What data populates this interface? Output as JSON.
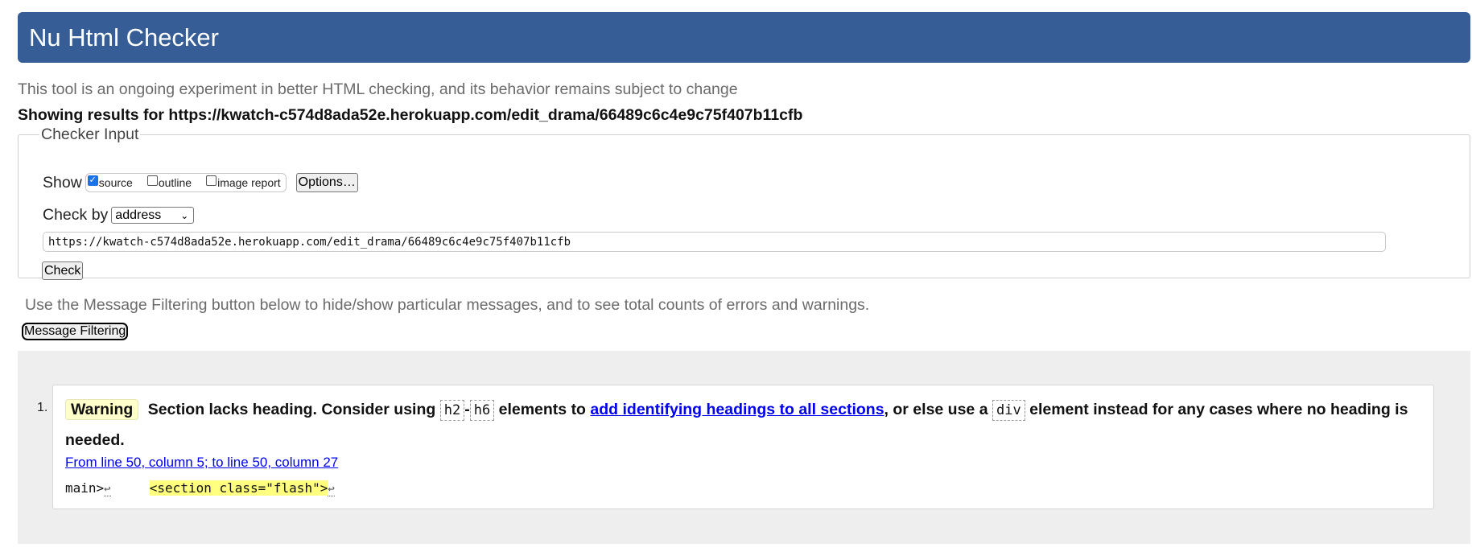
{
  "header": {
    "title": "Nu Html Checker"
  },
  "intro": "This tool is an ongoing experiment in better HTML checking, and its behavior remains subject to change",
  "showing": "Showing results for https://kwatch-c574d8ada52e.herokuapp.com/edit_drama/66489c6c4e9c75f407b11cfb",
  "checker_input": {
    "legend": "Checker Input",
    "show_label": "Show",
    "show_options": [
      {
        "label": "source",
        "checked": true
      },
      {
        "label": "outline",
        "checked": false
      },
      {
        "label": "image report",
        "checked": false
      }
    ],
    "options_button": "Options…",
    "check_by_label": "Check by",
    "check_by_selected": "address",
    "url_value": "https://kwatch-c574d8ada52e.herokuapp.com/edit_drama/66489c6c4e9c75f407b11cfb",
    "check_button": "Check"
  },
  "filtering": {
    "note": "Use the Message Filtering button below to hide/show particular messages, and to see total counts of errors and warnings.",
    "button": "Message Filtering"
  },
  "messages": [
    {
      "number": "1.",
      "type": "Warning",
      "text_1": "Section lacks heading. Consider using",
      "code_1": "h2",
      "dash": "-",
      "code_2": "h6",
      "text_2": "elements to",
      "link": "add identifying headings to all sections",
      "text_3": ", or else use a",
      "code_3": "div",
      "text_4": "element instead for any cases where no heading is needed.",
      "location": "From line 50, column 5; to line 50, column 27",
      "extract_pre": "main>",
      "extract_gap": "     ",
      "extract_highlight": "<section class=\"flash\">",
      "lf_symbol": "↩"
    }
  ]
}
